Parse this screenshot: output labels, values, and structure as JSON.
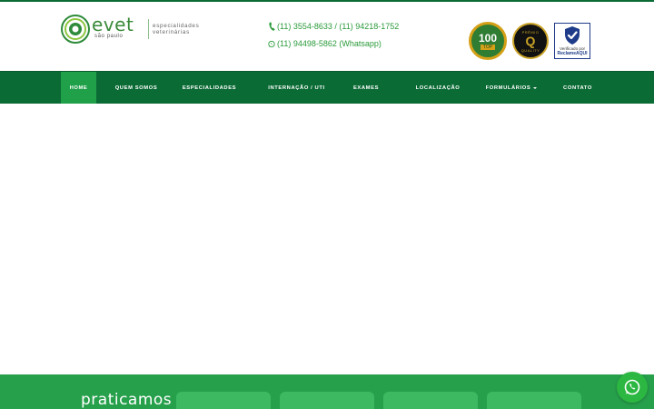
{
  "brand": {
    "name": "evet",
    "city": "são paulo",
    "tagline_line1": "especialidades",
    "tagline_line2": "veterinárias",
    "color_green": "#0b6b35",
    "color_accent": "#27a04c"
  },
  "contacts": {
    "phones": "(11) 3554-8633 / (11) 94218-1752",
    "phone_icon": "phone-icon",
    "whatsapp": "(11) 94498-5862 (Whatsapp)",
    "whatsapp_icon": "whatsapp-icon"
  },
  "badges": {
    "top100_number": "100",
    "top100_label": "TOP",
    "premio_top": "PRÊMIO",
    "premio_letter": "Q",
    "premio_bottom": "QUALITY",
    "reclame_line1": "Verificado por",
    "reclame_line2": "ReclameAQUI"
  },
  "nav": {
    "items": [
      {
        "label": "HOME",
        "active": true
      },
      {
        "label": "QUEM SOMOS",
        "active": false
      },
      {
        "label": "ESPECIALIDADES",
        "active": false
      },
      {
        "label": "INTERNAÇÃO / UTI",
        "active": false
      },
      {
        "label": "EXAMES",
        "active": false
      },
      {
        "label": "LOCALIZAÇÃO",
        "active": false
      },
      {
        "label": "FORMULÁRIOS",
        "active": false,
        "dropdown": true
      },
      {
        "label": "CONTATO",
        "active": false
      }
    ]
  },
  "section": {
    "title": "praticamos"
  },
  "floating": {
    "whatsapp_icon": "whatsapp-icon"
  }
}
